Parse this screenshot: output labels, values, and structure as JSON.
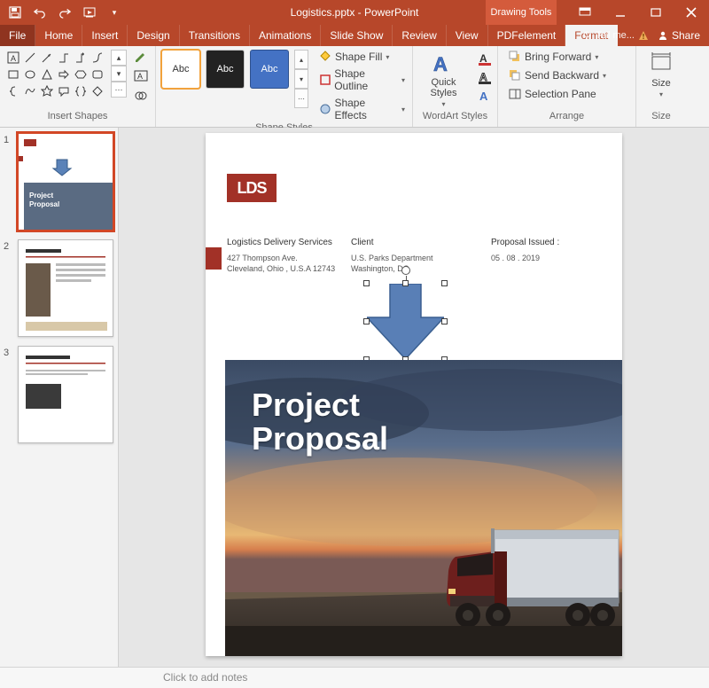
{
  "window": {
    "title": "Logistics.pptx - PowerPoint",
    "context_tab": "Drawing Tools",
    "tell_me": "Tell me...",
    "share": "Share"
  },
  "tabs": [
    "File",
    "Home",
    "Insert",
    "Design",
    "Transitions",
    "Animations",
    "Slide Show",
    "Review",
    "View",
    "PDFelement",
    "Format"
  ],
  "active_tab": "Format",
  "ribbon": {
    "insert_shapes": {
      "label": "Insert Shapes"
    },
    "shape_styles": {
      "label": "Shape Styles",
      "swatch": "Abc",
      "fill": "Shape Fill",
      "outline": "Shape Outline",
      "effects": "Shape Effects"
    },
    "wordart": {
      "label": "WordArt Styles",
      "quick": "Quick Styles"
    },
    "arrange": {
      "label": "Arrange",
      "bring_forward": "Bring Forward",
      "send_backward": "Send Backward",
      "selection_pane": "Selection Pane"
    },
    "size": {
      "label": "Size",
      "btn": "Size"
    }
  },
  "thumbnails": [
    1,
    2,
    3
  ],
  "slide": {
    "logo": "LDS",
    "col1_head": "Logistics Delivery Services",
    "col1_sub": "427 Thompson Ave.\nCleveland, Ohio , U.S.A 12743",
    "col2_head": "Client",
    "col2_sub": "U.S. Parks Department\nWashington, DC",
    "col3_head": "Proposal Issued :",
    "col3_sub": "05 . 08 . 2019",
    "hero_title": "Project\nProposal"
  },
  "notes_placeholder": "Click to add notes"
}
